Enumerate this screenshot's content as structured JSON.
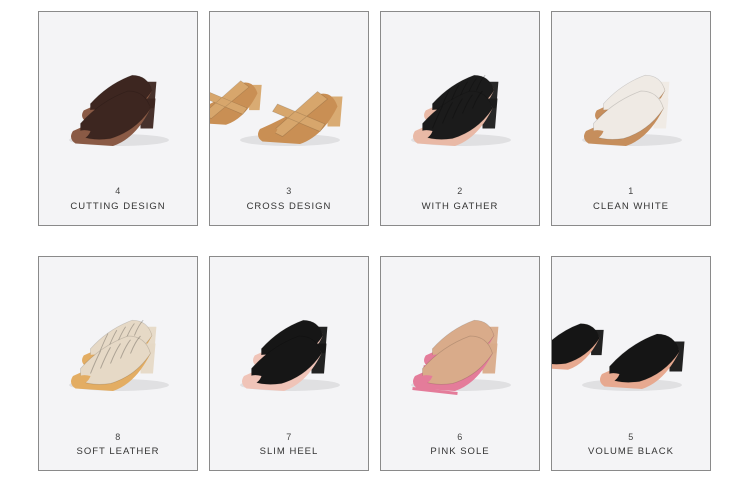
{
  "products": [
    {
      "id": "cutting-design",
      "number": "4",
      "name": "CUTTING DESIGN",
      "color": "#3d2620",
      "sole": "#8a5a45",
      "style": "cut"
    },
    {
      "id": "cross-design",
      "number": "3",
      "name": "CROSS DESIGN",
      "color": "#d7a66c",
      "sole": "#c98f54",
      "style": "cross"
    },
    {
      "id": "with-gather",
      "number": "2",
      "name": "WITH GATHER",
      "color": "#1b1b1b",
      "sole": "#e9b9a6",
      "style": "gather"
    },
    {
      "id": "clean-white",
      "number": "1",
      "name": "CLEAN WHITE",
      "color": "#efeae4",
      "sole": "#c68e5c",
      "style": "white"
    },
    {
      "id": "soft-leather",
      "number": "8",
      "name": "SOFT LEATHER",
      "color": "#e6d9c6",
      "sole": "#e3ad63",
      "style": "soft"
    },
    {
      "id": "slim-heel",
      "number": "7",
      "name": "SLIM HEEL",
      "color": "#161616",
      "sole": "#f0c4b8",
      "style": "slim"
    },
    {
      "id": "pink-sole",
      "number": "6",
      "name": "PINK SOLE",
      "color": "#d9ab8a",
      "sole": "#e47c9a",
      "style": "pink"
    },
    {
      "id": "volume-black",
      "number": "5",
      "name": "VOLUME BLACK",
      "color": "#151515",
      "sole": "#e7a990",
      "style": "volume"
    }
  ]
}
